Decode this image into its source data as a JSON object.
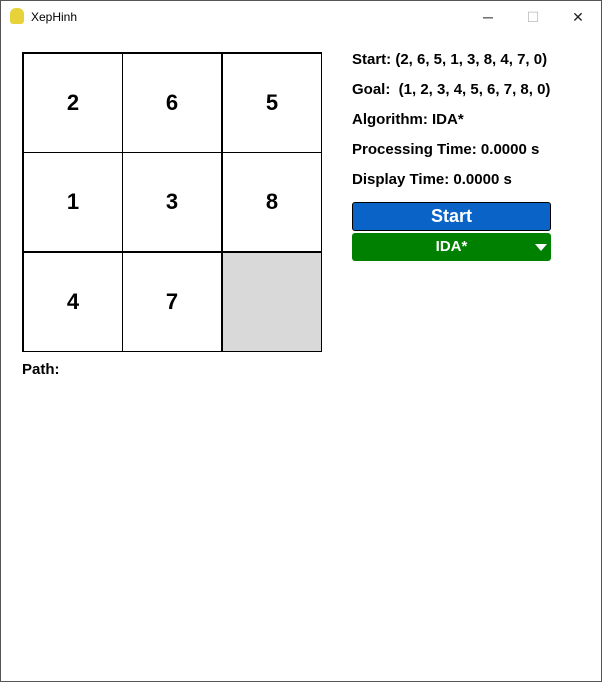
{
  "window": {
    "title": "XepHinh",
    "minimize": "─",
    "maximize": "☐",
    "close": "✕"
  },
  "board": [
    "2",
    "6",
    "5",
    "1",
    "3",
    "8",
    "4",
    "7",
    ""
  ],
  "info": {
    "start": "Start: (2, 6, 5, 1, 3, 8, 4, 7, 0)",
    "goal": "Goal:  (1, 2, 3, 4, 5, 6, 7, 8, 0)",
    "algorithm": "Algorithm: IDA*",
    "processing": "Processing Time: 0.0000 s",
    "display": "Display Time: 0.0000 s"
  },
  "buttons": {
    "start": "Start",
    "algorithm_selected": "IDA*"
  },
  "path_label": "Path:",
  "colors": {
    "start": "#0a64c8",
    "dropdown": "#008000",
    "blank": "#d9d9d9"
  }
}
